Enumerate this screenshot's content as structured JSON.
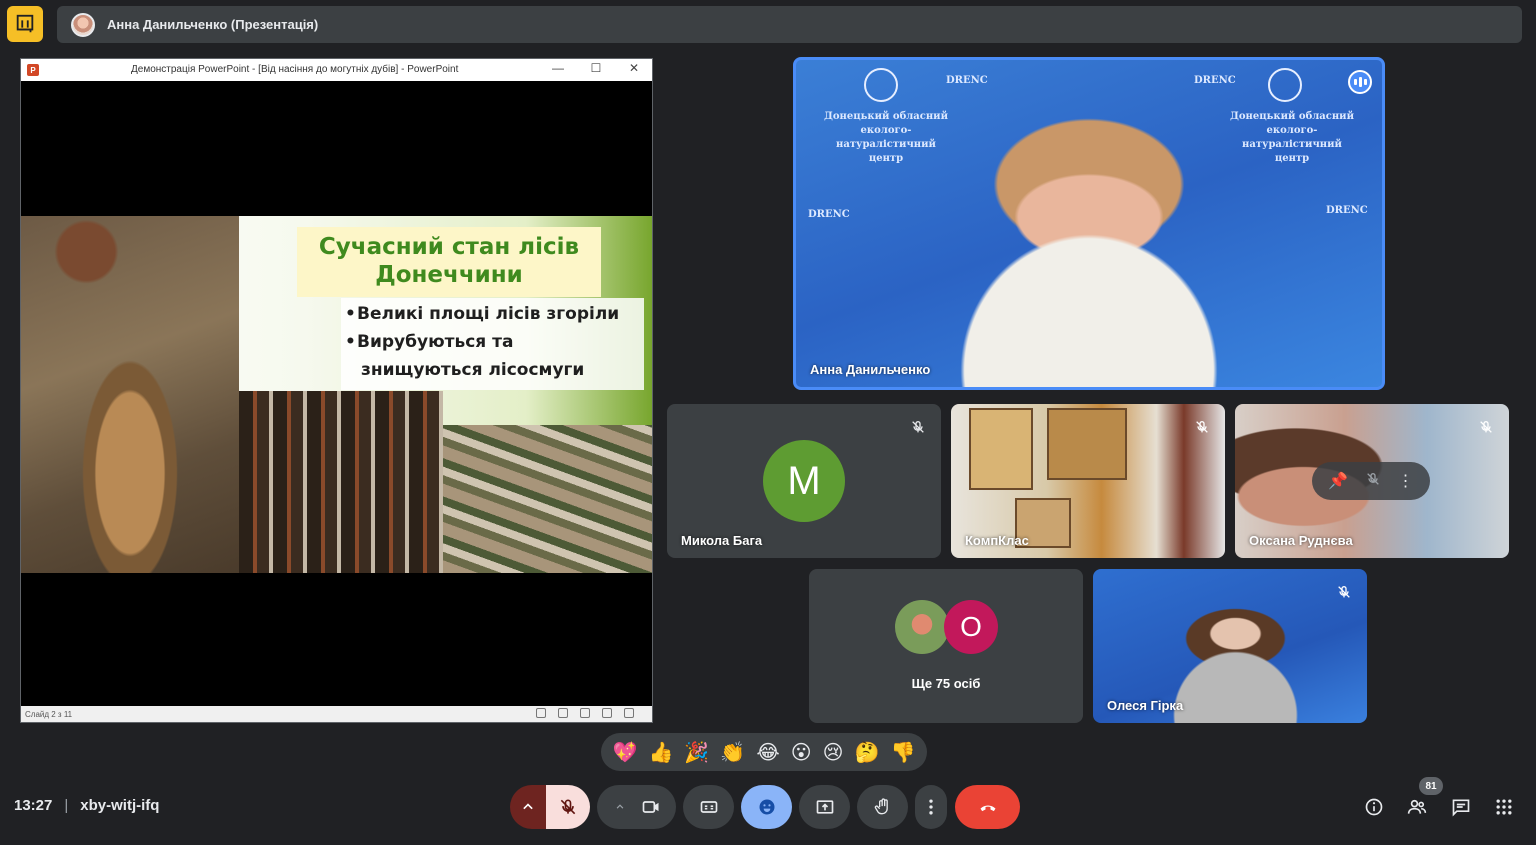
{
  "app": {
    "logo_icon": "present-screen-icon",
    "logo_color": "#f6bf26"
  },
  "presenter_bar": {
    "label": "Анна Данильченко (Презентація)"
  },
  "ppt": {
    "window_title": "Демонстрація PowerPoint - [Від насіння до могутніх дубів] - PowerPoint",
    "minimize": "—",
    "maximize": "☐",
    "close": "✕",
    "slide_title_line1": "Сучасний стан лісів",
    "slide_title_line2": "Донеччини",
    "bullet1": "Великі площі лісів згоріли",
    "bullet2_line1": "Вирубуються та",
    "bullet2_line2": "знищуються лісосмуги",
    "status_text": "Слайд 2 з 11"
  },
  "speaker": {
    "name": "Анна Данильченко",
    "bg_brand": "DRENC",
    "bg_org_line1": "Донецький обласний",
    "bg_org_line2": "еколого-натуралістичний",
    "bg_org_line3": "центр",
    "active_color": "#4a8cf7"
  },
  "tiles": {
    "mykola": {
      "name": "Микола Бага",
      "initial": "М",
      "avatar_color": "#5e9c32"
    },
    "kompklas": {
      "name": "КомпКлас"
    },
    "oksana": {
      "name": "Оксана Руднєва"
    },
    "more": {
      "label": "Ще 75 осіб",
      "initial": "О",
      "avatar_color": "#c2185b"
    },
    "olesia": {
      "name": "Олеся Гірка"
    }
  },
  "reactions": [
    "💖",
    "👍",
    "🎉",
    "👏",
    "😂",
    "😮",
    "😢",
    "🤔",
    "👎"
  ],
  "bottom": {
    "time": "13:27",
    "separator": "|",
    "meeting_code": "xby-witj-ifq",
    "participants_count": "81",
    "end_call_color": "#ea4335",
    "mic_off_color": "#f9dedc"
  }
}
